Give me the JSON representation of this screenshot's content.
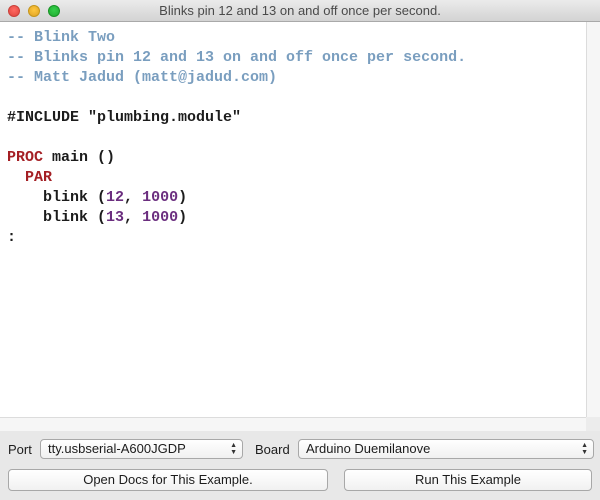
{
  "window": {
    "title": "Blinks pin 12 and 13 on and off once per second."
  },
  "editor": {
    "lines": [
      [
        {
          "t": "-- Blink Two",
          "k": "comment"
        }
      ],
      [
        {
          "t": "-- Blinks pin 12 and 13 on and off once per second.",
          "k": "comment"
        }
      ],
      [
        {
          "t": "-- Matt Jadud (matt@jadud.com)",
          "k": "comment"
        }
      ],
      [
        {
          "t": "",
          "k": "plain"
        }
      ],
      [
        {
          "t": "#INCLUDE \"plumbing.module\"",
          "k": "plain"
        }
      ],
      [
        {
          "t": "",
          "k": "plain"
        }
      ],
      [
        {
          "t": "PROC",
          "k": "keyword"
        },
        {
          "t": " main ()",
          "k": "plain"
        }
      ],
      [
        {
          "t": "  ",
          "k": "plain"
        },
        {
          "t": "PAR",
          "k": "keyword"
        }
      ],
      [
        {
          "t": "    blink (",
          "k": "plain"
        },
        {
          "t": "12",
          "k": "num"
        },
        {
          "t": ", ",
          "k": "plain"
        },
        {
          "t": "1000",
          "k": "num"
        },
        {
          "t": ")",
          "k": "plain"
        }
      ],
      [
        {
          "t": "    blink (",
          "k": "plain"
        },
        {
          "t": "13",
          "k": "num"
        },
        {
          "t": ", ",
          "k": "plain"
        },
        {
          "t": "1000",
          "k": "num"
        },
        {
          "t": ")",
          "k": "plain"
        }
      ],
      [
        {
          "t": ":",
          "k": "plain"
        }
      ]
    ]
  },
  "controls": {
    "port_label": "Port",
    "port_value": "tty.usbserial-A600JGDP",
    "board_label": "Board",
    "board_value": "Arduino Duemilanove",
    "open_docs_label": "Open Docs for This Example.",
    "run_label": "Run This Example"
  },
  "colors": {
    "comment": "#7a9ebf",
    "keyword": "#a41f24",
    "number": "#6b2e7f"
  }
}
